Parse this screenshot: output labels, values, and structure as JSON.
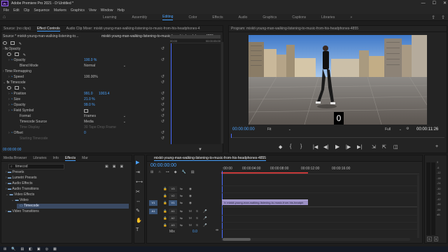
{
  "titlebar": {
    "logo_text": "Pr",
    "title": "Adobe Premiere Pro 2021 - D:\\Untitled *",
    "menu": [
      "File",
      "Edit",
      "Clip",
      "Sequence",
      "Markers",
      "Graphics",
      "View",
      "Window",
      "Help"
    ],
    "minimize": "—",
    "maximize": "☐",
    "close": "✕"
  },
  "workspace": {
    "tabs": [
      "Learning",
      "Assembly",
      "Editing",
      "Color",
      "Effects",
      "Audio",
      "Graphics",
      "Captions",
      "Libraries"
    ],
    "active_tab": "Editing",
    "more": "»"
  },
  "source_panel": {
    "tabs": [
      "Source: (no clips)",
      "Effect Controls",
      "Audio Clip Mixer: mixkit-young-man-walking-listening-to-music-from-his-headphones-4"
    ],
    "active_tab": "Effect Controls",
    "source_line": "Source * mixkit-young-man-walking-listening-to...",
    "clip_line": "mixkit-young-man-walking-listening-to-music-from-his-headphones-4855...",
    "timecodes": [
      "00:00",
      "00:00:05:00",
      "00:00:10:00"
    ],
    "rows": {
      "fx_opacity": "Opacity",
      "opacity_label": "Opacity",
      "opacity_value": "100.0 %",
      "blend_label": "Blend Mode",
      "blend_value": "Normal",
      "time_remap": "Time Remapping",
      "speed_label": "Speed",
      "speed_value": "100.00%",
      "timecode_fx": "Timecode",
      "position_label": "Position",
      "position_x": "991.0",
      "position_y": "1003.4",
      "size_label": "Size",
      "size_value": "21.0 %",
      "t_opacity_label": "Opacity",
      "t_opacity_value": "99.0 %",
      "field_symbol": "Field Symbol",
      "format_label": "Format",
      "format_value": "Frames",
      "tc_source_label": "Timecode Source",
      "tc_source_value": "Media",
      "time_display_label": "Time Display",
      "time_display_value": "30 Tape Drop Frame",
      "offset_label": "Offset",
      "offset_value": "0",
      "start_tc_label": "Starting Timecode"
    },
    "current_tc": "00:00:00:00"
  },
  "program_panel": {
    "title": "Program: mixkit-young-man-walking-listening-to-music-from-his-headphones-4855",
    "timecode": "00:00:00:00",
    "fit": "Fit",
    "quality": "Full",
    "duration": "00:00:11:26",
    "overlay_tc": "0",
    "transport": [
      "◆",
      "{",
      "}",
      "|◀",
      "◀|",
      "▶",
      "|▶",
      "▶|",
      "⇲",
      "⇱",
      "◫",
      "+"
    ]
  },
  "effects_panel": {
    "tabs": [
      "Media Browser",
      "Libraries",
      "Info",
      "Effects",
      "Mar"
    ],
    "active_tab": "Effects",
    "search_value": "timecod",
    "tree": [
      {
        "label": "Presets",
        "level": 0
      },
      {
        "label": "Lumetri Presets",
        "level": 0
      },
      {
        "label": "Audio Effects",
        "level": 0
      },
      {
        "label": "Audio Transitions",
        "level": 0
      },
      {
        "label": "Video Effects",
        "level": 0
      },
      {
        "label": "Video",
        "level": 1
      },
      {
        "label": "Timecode",
        "level": 2,
        "selected": true
      },
      {
        "label": "Video Transitions",
        "level": 0
      }
    ]
  },
  "timeline_panel": {
    "tab": "mixkit-young-man-walking-listening-to-music-from-his-headphones-4855",
    "timecode": "00:00:00:00",
    "ruler": [
      ":00:00",
      "00:00:04:00",
      "00:00:08:00",
      "00:00:12:00",
      "00:00:16:00"
    ],
    "video_tracks": [
      "V3",
      "V2",
      "V1"
    ],
    "audio_tracks": [
      "A1",
      "A2",
      "A3"
    ],
    "source_labels": [
      "V1",
      "A1"
    ],
    "mix_label": "Mix",
    "mix_value": "0.0",
    "clip_label": "mixkit-young-man-walking-listening-to-music-from-his-headph",
    "meter_labels": [
      "0",
      "-6",
      "-12",
      "-18",
      "-24",
      "-30",
      "-36",
      "-42",
      "-48",
      "-54",
      "dB"
    ],
    "meter_footer": [
      "S",
      "S"
    ]
  },
  "tools": [
    "▶",
    "⇥",
    "⟷",
    "✂",
    "↔",
    "✎",
    "✋",
    "T"
  ],
  "taskbar": {
    "items": [
      "⊞",
      "🔍",
      "▤",
      "◧",
      "▣",
      "◎",
      "▦"
    ]
  },
  "colors": {
    "accent": "#4aa3ff",
    "clip": "#9b8fc4",
    "playhead": "#4a6cff"
  }
}
